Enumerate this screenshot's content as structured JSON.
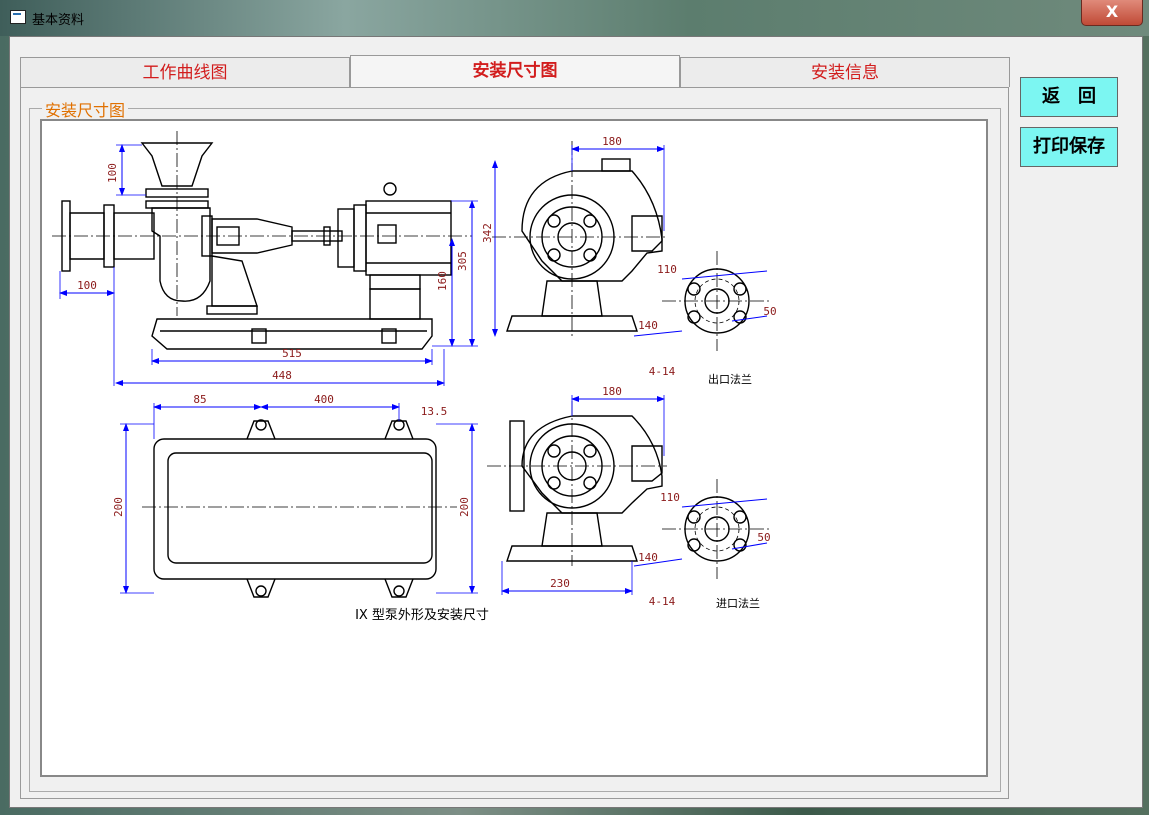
{
  "window": {
    "title": "基本资料",
    "close_label": "X"
  },
  "tabs": [
    {
      "label": "工作曲线图",
      "active": false
    },
    {
      "label": "安装尺寸图",
      "active": true
    },
    {
      "label": "安装信息",
      "active": false
    }
  ],
  "group": {
    "label": "安装尺寸图"
  },
  "buttons": {
    "back": "返　回",
    "print_save": "打印保存"
  },
  "drawing": {
    "caption": "IX 型泵外形及安装尺寸",
    "outlet_flange": "出口法兰",
    "inlet_flange": "进口法兰",
    "dims": {
      "side_100_top": "100",
      "side_100_left": "100",
      "side_515": "515",
      "side_448": "448",
      "side_305": "305",
      "side_160": "160",
      "end_180_top": "180",
      "end_342": "342",
      "out_110": "110",
      "out_50": "50",
      "out_140": "140",
      "out_4_14": "4-14",
      "plan_85": "85",
      "plan_400": "400",
      "plan_13_5": "13.5",
      "plan_200_left": "200",
      "plan_200_right": "200",
      "end2_180": "180",
      "end2_230": "230",
      "in_110": "110",
      "in_50": "50",
      "in_140": "140",
      "in_4_14": "4-14"
    }
  },
  "colors": {
    "dimension_line": "#0000ff",
    "dimension_text": "#8b1a1a",
    "tab_text": "#d21d1d",
    "button_bg": "#7cf6f2"
  }
}
